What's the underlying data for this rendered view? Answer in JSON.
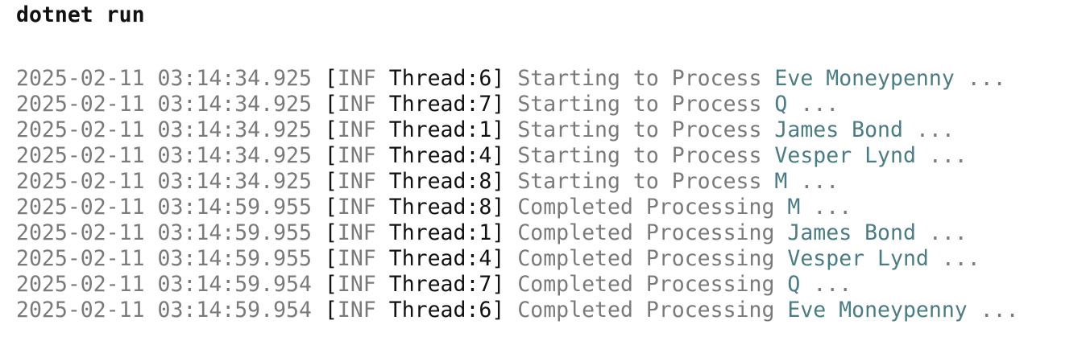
{
  "command": "dotnet run",
  "colors": {
    "timestamp": "#7a7a7a",
    "thread": "#111111",
    "name": "#4a7c86"
  },
  "log": [
    {
      "timestamp": "2025-02-11 03:14:34.925",
      "level": "INF",
      "thread": "Thread:6",
      "message": "Starting to Process",
      "name": "Eve Moneypenny",
      "suffix": "..."
    },
    {
      "timestamp": "2025-02-11 03:14:34.925",
      "level": "INF",
      "thread": "Thread:7",
      "message": "Starting to Process",
      "name": "Q",
      "suffix": "..."
    },
    {
      "timestamp": "2025-02-11 03:14:34.925",
      "level": "INF",
      "thread": "Thread:1",
      "message": "Starting to Process",
      "name": "James Bond",
      "suffix": "..."
    },
    {
      "timestamp": "2025-02-11 03:14:34.925",
      "level": "INF",
      "thread": "Thread:4",
      "message": "Starting to Process",
      "name": "Vesper Lynd",
      "suffix": "..."
    },
    {
      "timestamp": "2025-02-11 03:14:34.925",
      "level": "INF",
      "thread": "Thread:8",
      "message": "Starting to Process",
      "name": "M",
      "suffix": "..."
    },
    {
      "timestamp": "2025-02-11 03:14:59.955",
      "level": "INF",
      "thread": "Thread:8",
      "message": "Completed Processing",
      "name": "M",
      "suffix": "..."
    },
    {
      "timestamp": "2025-02-11 03:14:59.955",
      "level": "INF",
      "thread": "Thread:1",
      "message": "Completed Processing",
      "name": "James Bond",
      "suffix": "..."
    },
    {
      "timestamp": "2025-02-11 03:14:59.955",
      "level": "INF",
      "thread": "Thread:4",
      "message": "Completed Processing",
      "name": "Vesper Lynd",
      "suffix": "..."
    },
    {
      "timestamp": "2025-02-11 03:14:59.954",
      "level": "INF",
      "thread": "Thread:7",
      "message": "Completed Processing",
      "name": "Q",
      "suffix": "..."
    },
    {
      "timestamp": "2025-02-11 03:14:59.954",
      "level": "INF",
      "thread": "Thread:6",
      "message": "Completed Processing",
      "name": "Eve Moneypenny",
      "suffix": "..."
    }
  ]
}
